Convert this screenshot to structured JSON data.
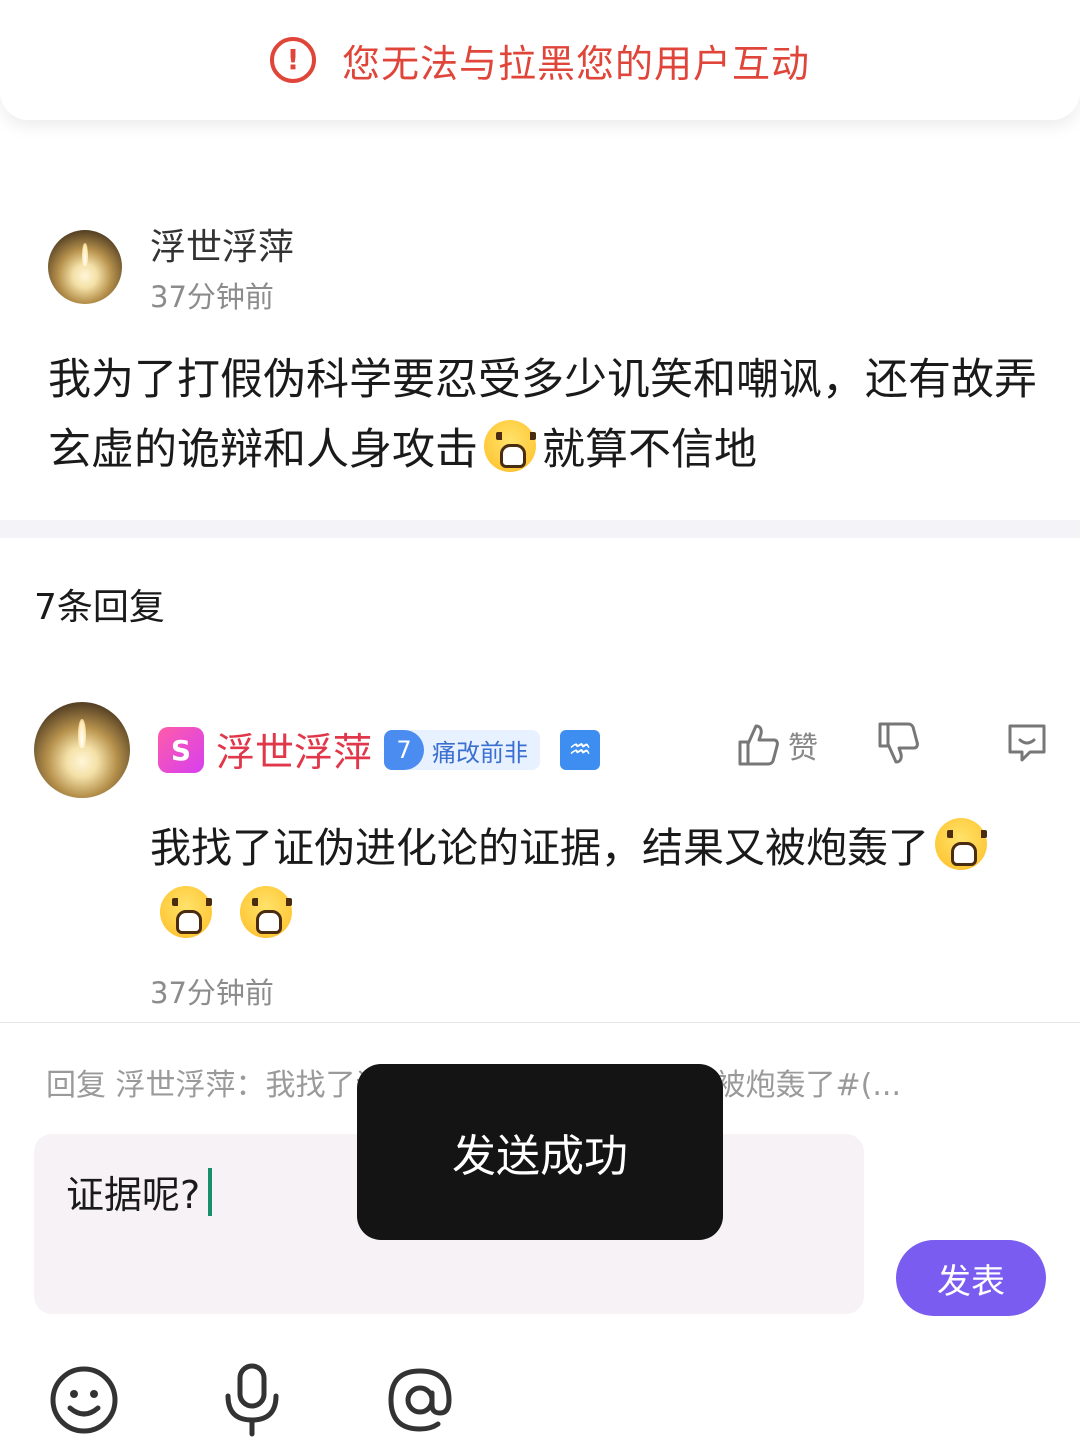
{
  "banner": {
    "icon": "exclamation-circle-icon",
    "text": "您无法与拉黑您的用户互动",
    "color": "#e0453a"
  },
  "post": {
    "author": "浮世浮萍",
    "time": "37分钟前",
    "body_part1": "我为了打假伪科学要忍受多少讥笑和嘲讽，还有故弄玄虚的诡辩和人身攻击",
    "body_part2": "就算不信地",
    "emoji": "crying-face-emoji"
  },
  "replies": {
    "count_label": "7条回复"
  },
  "reply": {
    "vip_icon_letter": "S",
    "author": "浮世浮萍",
    "level": "7",
    "level_title": "痛改前非",
    "zodiac_symbol": "♒",
    "like_label": "赞",
    "body": "我找了证伪进化论的证据，结果又被炮轰了",
    "emoji": "crying-face-emoji",
    "time": "37分钟前",
    "name_color": "#e0384a"
  },
  "composer": {
    "quote": "回复 浮世浮萍：我找了证伪进化论的证据，结果又被炮轰了#(...",
    "value": "证据呢?",
    "publish_label": "发表",
    "accent": "#7a5cf0"
  },
  "toolbar": {
    "icons": [
      "smiley-icon",
      "microphone-icon",
      "at-sign-icon"
    ]
  },
  "toast": {
    "text": "发送成功"
  }
}
